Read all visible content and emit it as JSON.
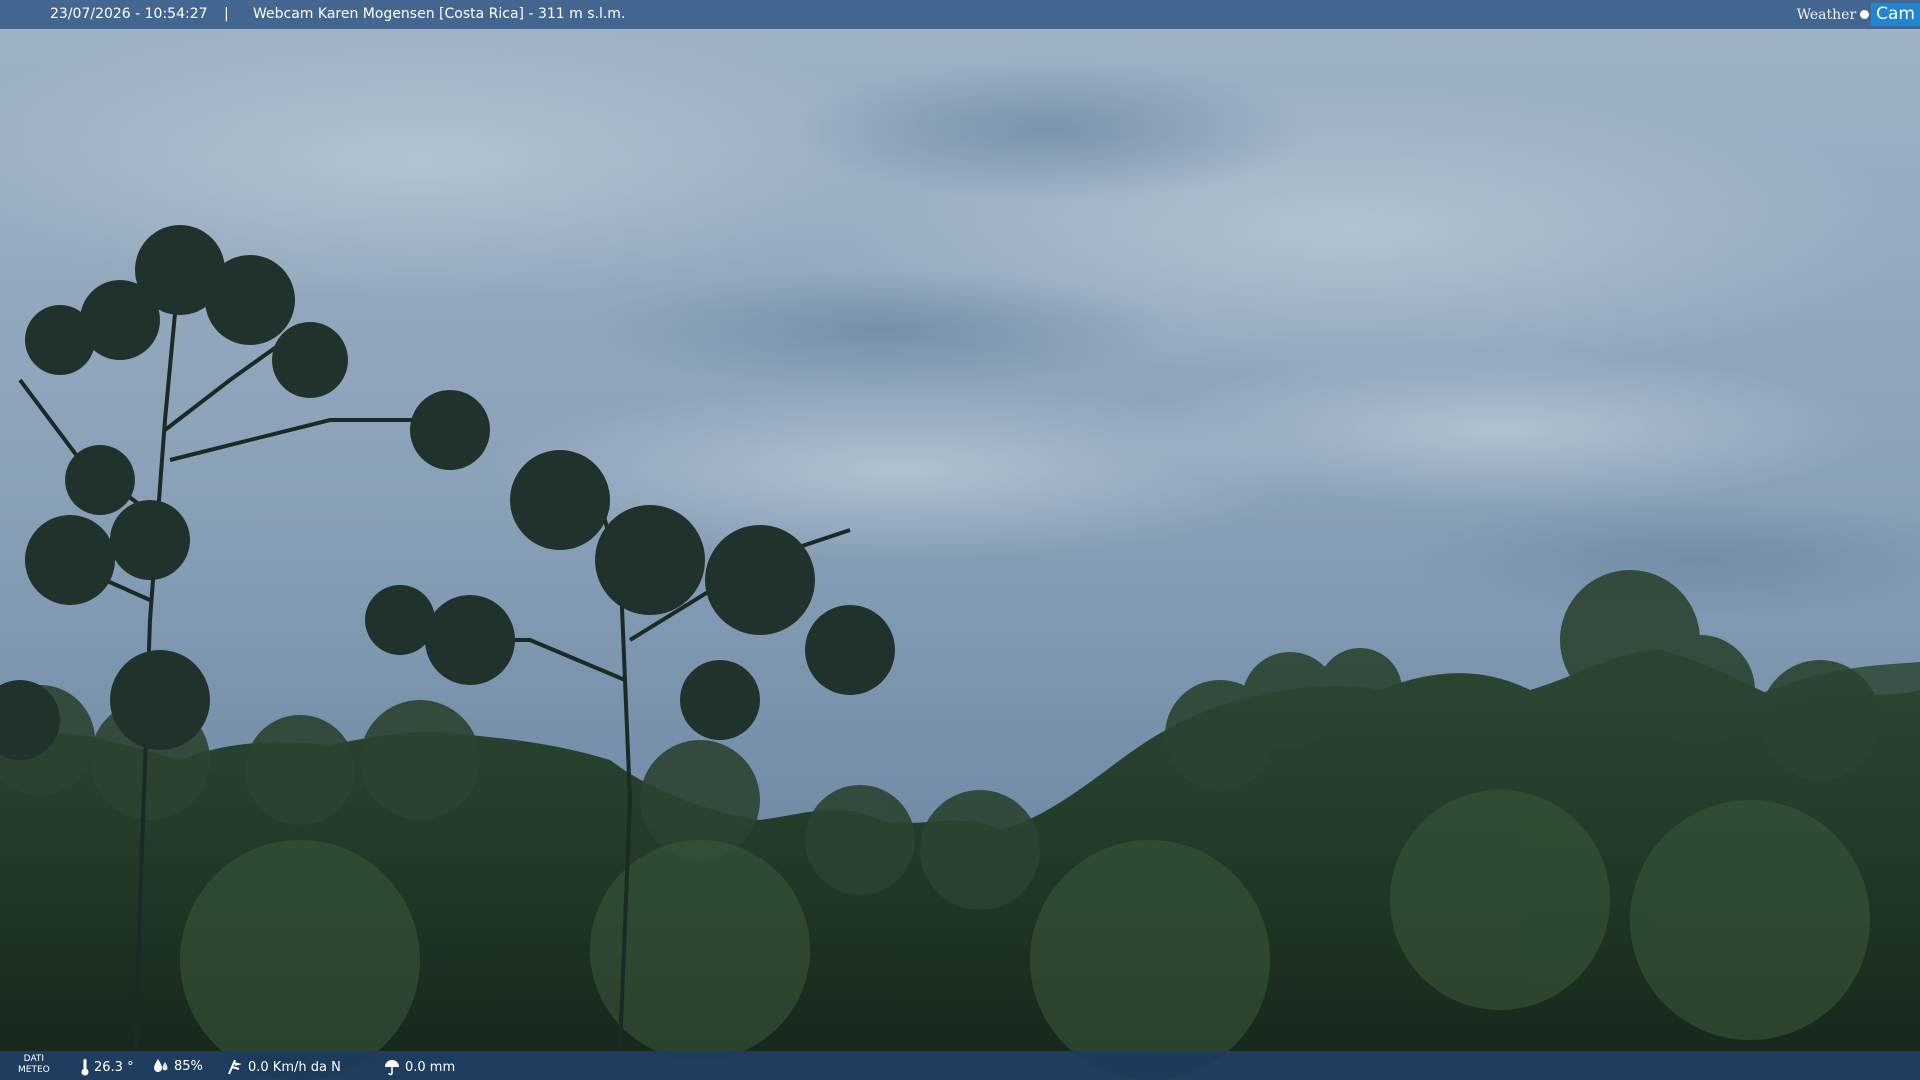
{
  "header": {
    "datetime": "23/07/2026 - 10:54:27",
    "separator": "|",
    "title": "Webcam Karen Mogensen [Costa Rica] - 311 m s.l.m."
  },
  "logo": {
    "weather": "Weather",
    "cam": "Cam"
  },
  "footer": {
    "label_line1": "DATI",
    "label_line2": "METEO",
    "temperature": "26.3 °",
    "humidity": "85%",
    "wind": "0.0 Km/h da N",
    "rain": "0.0 mm"
  },
  "colors": {
    "bar_top": "#3c608c",
    "bar_bottom": "#143456",
    "logo_accent": "#1e86d2"
  },
  "icons": {
    "temperature": "thermometer-icon",
    "humidity": "humidity-drops-icon",
    "wind": "wind-vane-icon",
    "rain": "umbrella-icon"
  }
}
